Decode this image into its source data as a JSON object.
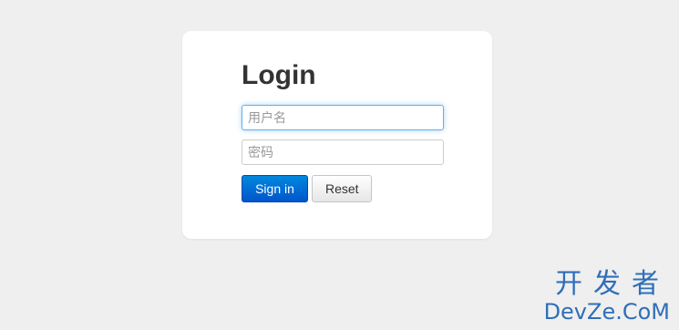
{
  "login": {
    "title": "Login",
    "username_placeholder": "用户名",
    "username_value": "",
    "password_placeholder": "密码",
    "password_value": "",
    "signin_label": "Sign in",
    "reset_label": "Reset"
  },
  "watermark": {
    "line1": "开发者",
    "line2": "DevZe.CoM"
  },
  "colors": {
    "page_bg": "#efefef",
    "card_bg": "#ffffff",
    "primary": "#0066cc",
    "focus": "#66afe9",
    "watermark": "#2f6fb8"
  }
}
